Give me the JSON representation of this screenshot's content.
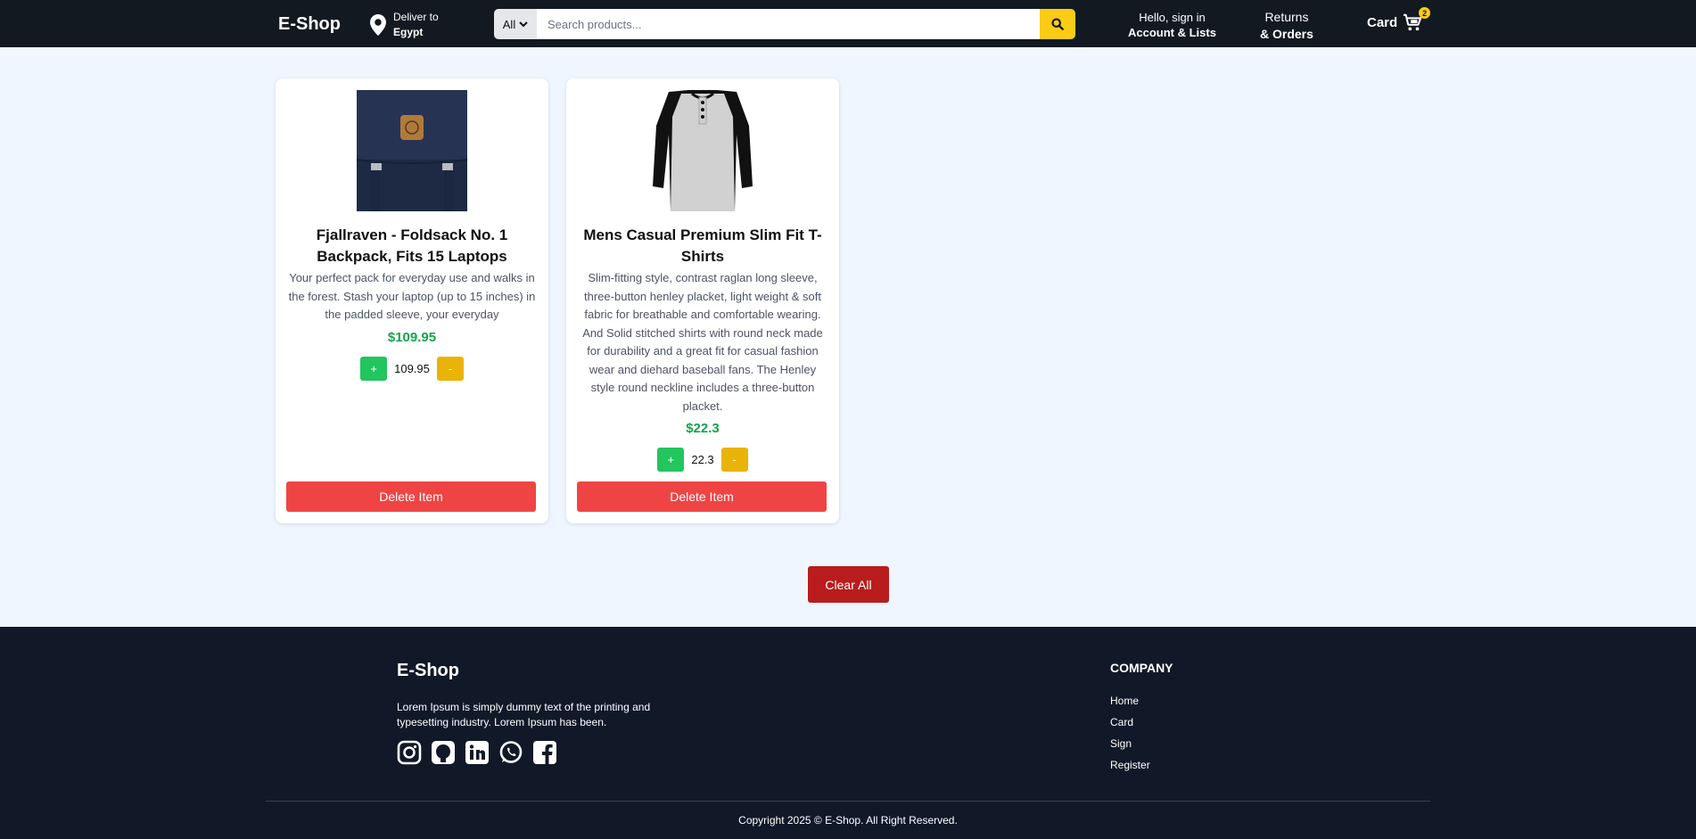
{
  "header": {
    "logo": "E-Shop",
    "deliver_line1": "Deliver to",
    "deliver_line2": "Egypt",
    "search_category": "All",
    "search_placeholder": "Search products...",
    "signin_line1": "Hello, sign in",
    "signin_line2": "Account & Lists",
    "returns_line1": "Returns",
    "returns_line2": "& Orders",
    "cart_label": "Card",
    "cart_count": "2"
  },
  "products": [
    {
      "title": "Fjallraven - Foldsack No. 1 Backpack, Fits 15 Laptops",
      "description": "Your perfect pack for everyday use and walks in the forest. Stash your laptop (up to 15 inches) in the padded sleeve, your everyday",
      "price": "$109.95",
      "plus": "+",
      "quantity_value": "109.95",
      "minus": "-",
      "delete_label": "Delete Item"
    },
    {
      "title": "Mens Casual Premium Slim Fit T-Shirts",
      "description": "Slim-fitting style, contrast raglan long sleeve, three-button henley placket, light weight & soft fabric for breathable and comfortable wearing. And Solid stitched shirts with round neck made for durability and a great fit for casual fashion wear and diehard baseball fans. The Henley style round neckline includes a three-button placket.",
      "price": "$22.3",
      "plus": "+",
      "quantity_value": "22.3",
      "minus": "-",
      "delete_label": "Delete Item"
    }
  ],
  "clear_all_label": "Clear All",
  "footer": {
    "logo": "E-Shop",
    "text": "Lorem Ipsum is simply dummy text of the printing and typesetting industry. Lorem Ipsum has been.",
    "socials": [
      "instagram-icon",
      "github-icon",
      "linkedin-icon",
      "whatsapp-icon",
      "facebook-icon"
    ],
    "company_heading": "COMPANY",
    "links": [
      "Home",
      "Card",
      "Sign",
      "Register"
    ],
    "copyright": "Copyright 2025 © E-Shop. All Right Reserved."
  },
  "colors": {
    "header_bg": "#131921",
    "accent_yellow": "#facc15",
    "green": "#22c55e",
    "price_green": "#16a34a",
    "delete_red": "#ef4444",
    "clear_red": "#b91c1c",
    "footer_bg": "#111827",
    "page_bg": "#eff6ff"
  }
}
